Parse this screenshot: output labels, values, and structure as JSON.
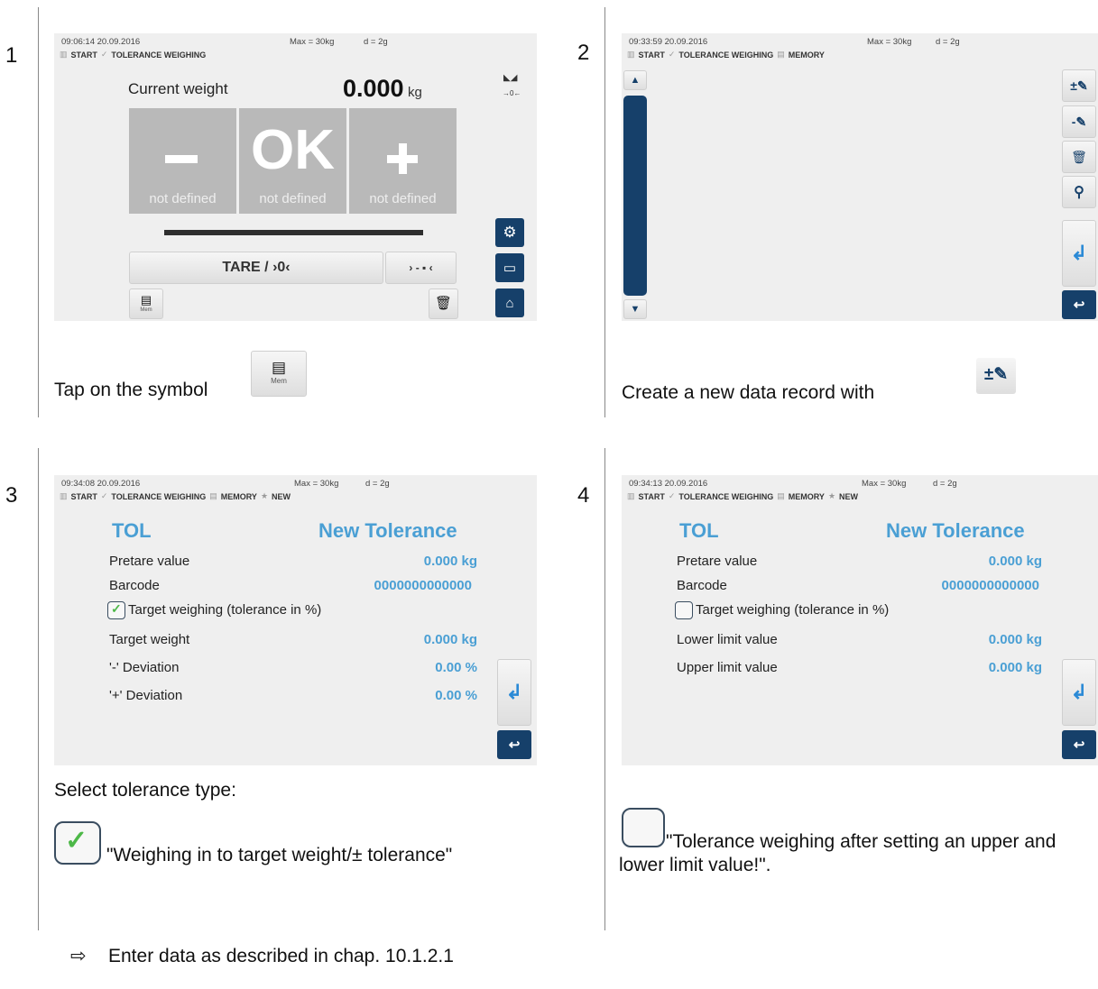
{
  "steps": [
    {
      "number": "1",
      "time": "09:06:14 20.09.2016",
      "max": "Max = 30kg",
      "d": "d = 2g",
      "breadcrumb": [
        "START",
        "TOLERANCE WEIGHING"
      ],
      "current_weight_label": "Current weight",
      "weight_value": "0.000",
      "weight_unit": "kg",
      "minus_label": "not defined",
      "ok_symbol": "OK",
      "ok_label": "not defined",
      "plus_label": "not defined",
      "tare_label": "TARE / ›0‹",
      "zero_label": "› - ▪ ‹",
      "mem_label": "Mem",
      "stable_indicator": "→0←",
      "caption": "Tap on the symbol"
    },
    {
      "number": "2",
      "time": "09:33:59 20.09.2016",
      "max": "Max = 30kg",
      "d": "d = 2g",
      "breadcrumb": [
        "START",
        "TOLERANCE WEIGHING",
        "MEMORY"
      ],
      "caption": "Create a new data record with"
    },
    {
      "number": "3",
      "time": "09:34:08 20.09.2016",
      "max": "Max = 30kg",
      "d": "d = 2g",
      "breadcrumb": [
        "START",
        "TOLERANCE WEIGHING",
        "MEMORY",
        "NEW"
      ],
      "title_left": "TOL",
      "title_right": "New Tolerance",
      "pretare_label": "Pretare value",
      "pretare_value": "0.000 kg",
      "barcode_label": "Barcode",
      "barcode_value": "0000000000000",
      "checkbox_label": "Target weighing (tolerance in %)",
      "checkbox_checked": true,
      "row4_label": "Target weight",
      "row4_value": "0.000 kg",
      "row5_label": "'-' Deviation",
      "row5_value": "0.00 %",
      "row6_label": "'+' Deviation",
      "row6_value": "0.00 %",
      "caption_title": "Select tolerance type:",
      "caption_option": "\"Weighing in to target weight/± tolerance\""
    },
    {
      "number": "4",
      "time": "09:34:13 20.09.2016",
      "max": "Max = 30kg",
      "d": "d = 2g",
      "breadcrumb": [
        "START",
        "TOLERANCE WEIGHING",
        "MEMORY",
        "NEW"
      ],
      "title_left": "TOL",
      "title_right": "New Tolerance",
      "pretare_label": "Pretare value",
      "pretare_value": "0.000 kg",
      "barcode_label": "Barcode",
      "barcode_value": "0000000000000",
      "checkbox_label": "Target weighing (tolerance in %)",
      "checkbox_checked": false,
      "row4_label": "Lower limit value",
      "row4_value": "0.000 kg",
      "row5_label": "Upper limit value",
      "row5_value": "0.000 kg",
      "caption_option": "\"Tolerance weighing after setting an upper and lower limit value!\"."
    }
  ],
  "footer": {
    "arrow": "⇨",
    "text": "Enter data as described in chap. 10.1.2.1"
  },
  "colors": {
    "navy": "#16406a",
    "accent_blue": "#4a9fd4",
    "button_grey": "#b9b9b9",
    "check_green": "#4db848"
  }
}
